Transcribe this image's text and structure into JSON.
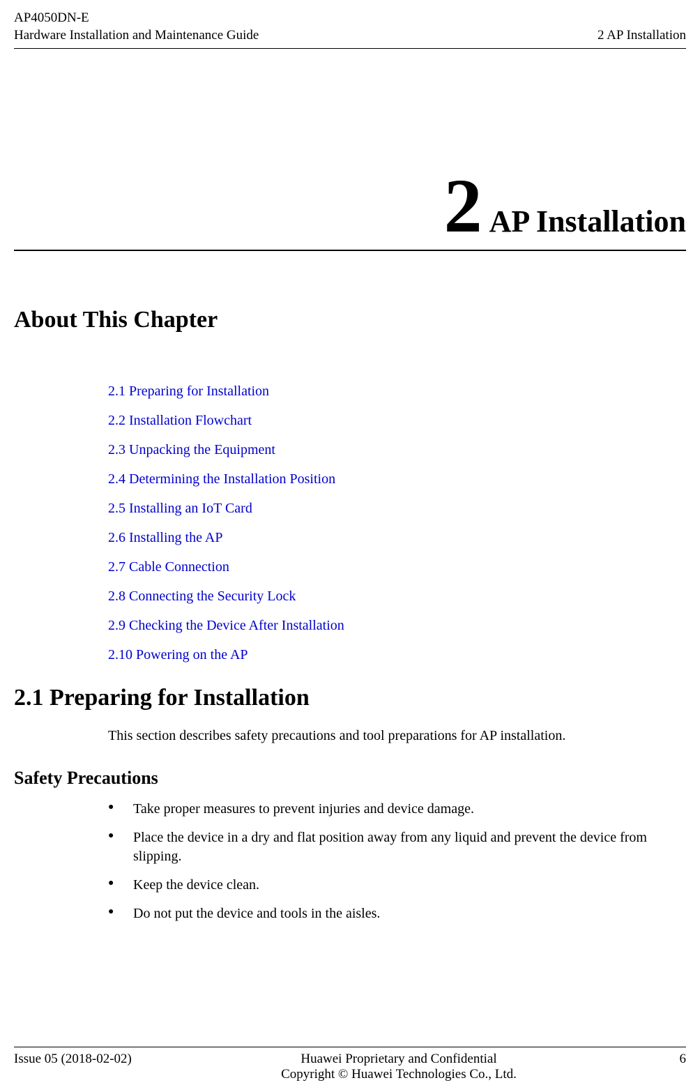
{
  "header": {
    "product": "AP4050DN-E",
    "guide": "Hardware Installation and Maintenance Guide",
    "section": "2 AP Installation"
  },
  "chapter": {
    "number": "2",
    "title": "AP Installation"
  },
  "about_heading": "About This Chapter",
  "toc": [
    "2.1 Preparing for Installation",
    "2.2 Installation Flowchart",
    "2.3 Unpacking the Equipment",
    "2.4 Determining the Installation Position",
    "2.5 Installing an IoT Card",
    "2.6 Installing the AP",
    "2.7 Cable Connection",
    "2.8 Connecting the Security Lock",
    "2.9 Checking the Device After Installation",
    "2.10 Powering on the AP"
  ],
  "section_heading": "2.1 Preparing for Installation",
  "section_intro": "This section describes safety precautions and tool preparations for AP installation.",
  "subsection_heading": "Safety Precautions",
  "bullets": [
    "Take proper measures to prevent injuries and device damage.",
    "Place the device in a dry and flat position away from any liquid and prevent the device from slipping.",
    "Keep the device clean.",
    "Do not put the device and tools in the aisles."
  ],
  "footer": {
    "issue": "Issue 05 (2018-02-02)",
    "line1": "Huawei Proprietary and Confidential",
    "line2": "Copyright © Huawei Technologies Co., Ltd.",
    "page": "6"
  }
}
